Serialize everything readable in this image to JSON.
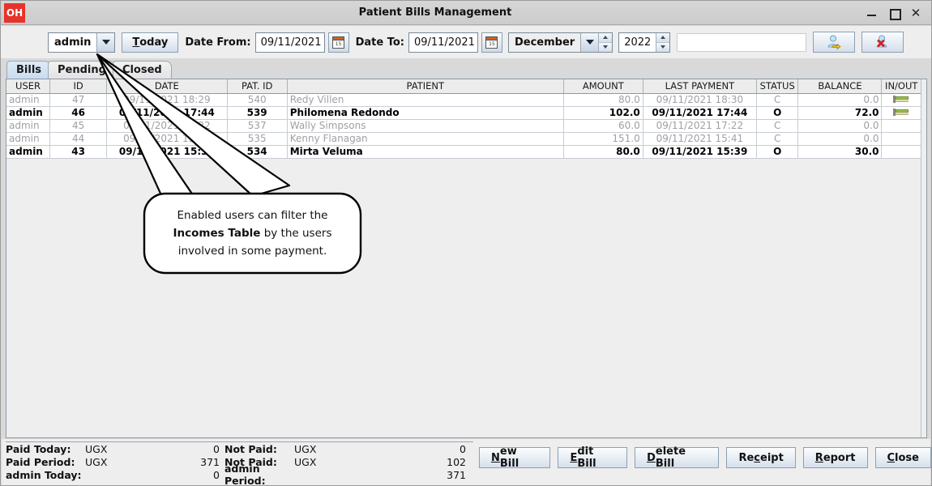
{
  "window": {
    "logo": "OH",
    "title": "Patient Bills Management",
    "minimize_icon": "minimize-icon",
    "maximize_icon": "maximize-icon",
    "close_icon": "close-icon"
  },
  "toolbar": {
    "user_combo_value": "admin",
    "today_button": "Today",
    "date_from_label": "Date From:",
    "date_from_value": "09/11/2021",
    "date_to_label": "Date To:",
    "date_to_value": "09/11/2021",
    "month_value": "December",
    "year_value": "2022",
    "search_value": "",
    "search_placeholder": "",
    "calendar_icon_day": "15",
    "user_apply_icon": "user-arrow-icon",
    "user_clear_icon": "user-delete-icon"
  },
  "tabs": [
    {
      "label": "Bills",
      "active": true
    },
    {
      "label": "Pending",
      "active": false
    },
    {
      "label": "Closed",
      "active": false
    }
  ],
  "table": {
    "columns": [
      "USER",
      "ID",
      "DATE",
      "PAT. ID",
      "PATIENT",
      "AMOUNT",
      "LAST PAYMENT",
      "STATUS",
      "BALANCE",
      "IN/OUT"
    ],
    "rows": [
      {
        "user": "admin",
        "id": "47",
        "date": "09/11/2021 18:29",
        "pat_id": "540",
        "patient": "Redy Villen",
        "amount": "80.0",
        "last_payment": "09/11/2021 18:30",
        "status": "C",
        "balance": "0.0",
        "inout": "bed-icon",
        "state": "closed"
      },
      {
        "user": "admin",
        "id": "46",
        "date": "09/11/2021 17:44",
        "pat_id": "539",
        "patient": "Philomena Redondo",
        "amount": "102.0",
        "last_payment": "09/11/2021 17:44",
        "status": "O",
        "balance": "72.0",
        "inout": "bed-icon",
        "state": "open"
      },
      {
        "user": "admin",
        "id": "45",
        "date": "09/11/2021 17:22",
        "pat_id": "537",
        "patient": "Wally Simpsons",
        "amount": "60.0",
        "last_payment": "09/11/2021 17:22",
        "status": "C",
        "balance": "0.0",
        "inout": "",
        "state": "closed"
      },
      {
        "user": "admin",
        "id": "44",
        "date": "09/11/2021 15:40",
        "pat_id": "535",
        "patient": "Kenny Flanagan",
        "amount": "151.0",
        "last_payment": "09/11/2021 15:41",
        "status": "C",
        "balance": "0.0",
        "inout": "",
        "state": "closed"
      },
      {
        "user": "admin",
        "id": "43",
        "date": "09/11/2021 15:39",
        "pat_id": "534",
        "patient": "Mirta Veluma",
        "amount": "80.0",
        "last_payment": "09/11/2021 15:39",
        "status": "O",
        "balance": "30.0",
        "inout": "",
        "state": "open"
      }
    ]
  },
  "callout": {
    "line1": "Enabled users can filter the",
    "bold": "Incomes Table",
    "line2_tail": " by the users",
    "line3": "involved in some payment."
  },
  "summary": {
    "rows": [
      {
        "k": "Paid Today:",
        "cur": "UGX",
        "v": "0",
        "k2": "Not Paid:",
        "cur2": "UGX",
        "v2": "0"
      },
      {
        "k": "Paid Period:",
        "cur": "UGX",
        "v": "371",
        "k2": "Not Paid:",
        "cur2": "UGX",
        "v2": "102"
      },
      {
        "k": "admin Today:",
        "cur": "",
        "v": "0",
        "k2": "admin Period:",
        "cur2": "",
        "v2": "371"
      }
    ]
  },
  "buttons": [
    {
      "pre": "",
      "mn": "N",
      "post": "ew Bill"
    },
    {
      "pre": "",
      "mn": "E",
      "post": "dit Bill"
    },
    {
      "pre": "",
      "mn": "D",
      "post": "elete Bill"
    },
    {
      "pre": "Re",
      "mn": "c",
      "post": "eipt"
    },
    {
      "pre": "",
      "mn": "R",
      "post": "eport"
    },
    {
      "pre": "",
      "mn": "C",
      "post": "lose"
    }
  ]
}
